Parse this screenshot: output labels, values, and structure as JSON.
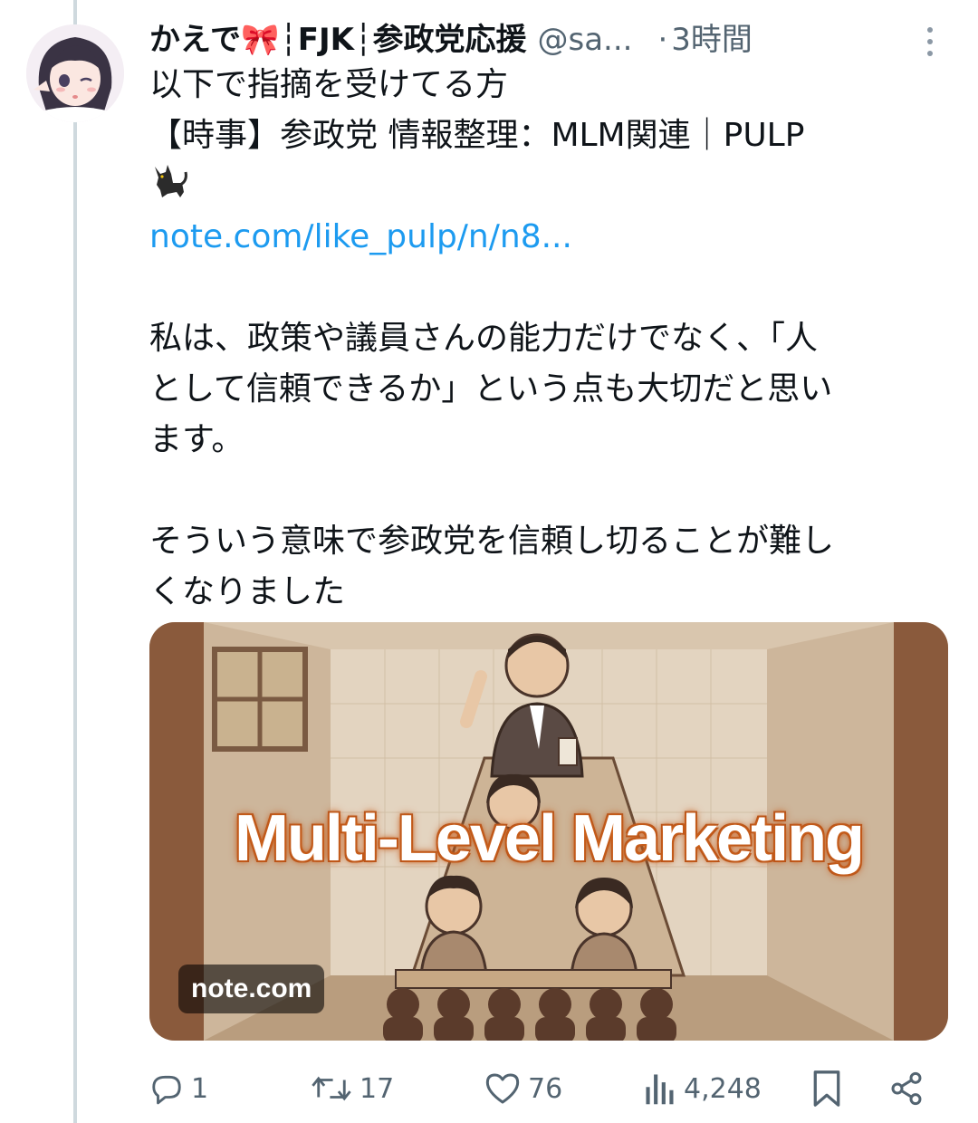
{
  "tweet": {
    "display_name": "かえで🎀┆FJK┆参政党応援",
    "handle": "@sa...",
    "separator": "·",
    "time": "3時間",
    "lines": [
      "以下で指摘を受けてる方",
      "【時事】参政党 情報整理：MLM関連｜PULP",
      "🐈‍⬛",
      "note.com/like_pulp/n/n8...",
      "",
      "私は、政策や議員さんの能力だけでなく、「人",
      "として信頼できるか」という点も大切だと思い",
      "ます。",
      "",
      "そういう意味で参政党を信頼し切ることが難し",
      "くなりました"
    ]
  },
  "card": {
    "overlay_title": "Multi-Level Marketing",
    "source": "note.com"
  },
  "actions": {
    "reply_count": "1",
    "repost_count": "17",
    "like_count": "76",
    "view_count": "4,248"
  },
  "icons": {
    "more": "more-vertical-icon",
    "reply": "reply-icon",
    "repost": "repost-icon",
    "like": "heart-icon",
    "views": "views-chart-icon",
    "bookmark": "bookmark-icon",
    "share": "share-icon"
  },
  "colors": {
    "text": "#0f1419",
    "secondary": "#536471",
    "link": "#1d9bf0",
    "thread_line": "#cfd9de"
  }
}
